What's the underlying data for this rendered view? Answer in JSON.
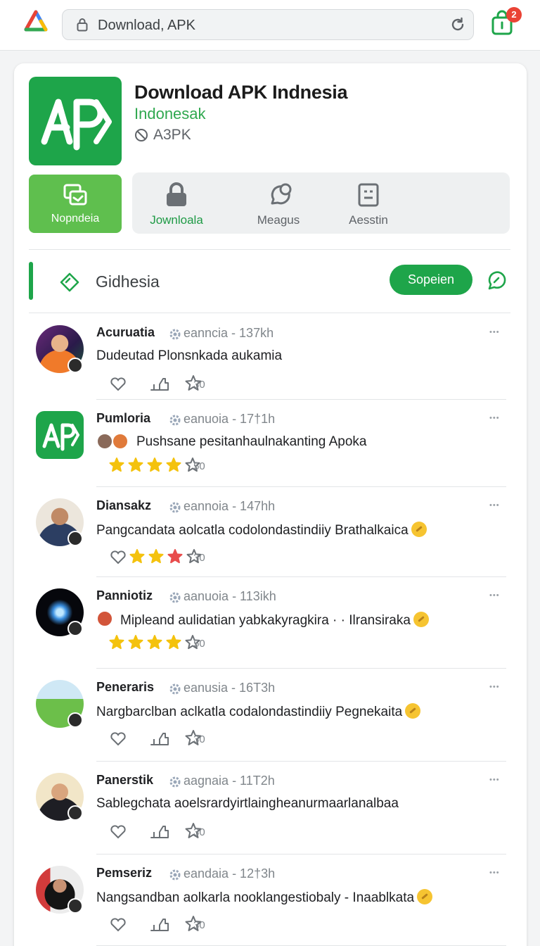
{
  "browser": {
    "url": "Download, APK",
    "notification_count": "2"
  },
  "app": {
    "title": "Download APK Indnesia",
    "subtitle": "Indonesak",
    "developer": "A3PK",
    "icon_text": "AP"
  },
  "actions": {
    "primary_label": "Nopndeia",
    "items": [
      {
        "label": "Jownloala",
        "icon": "lock-icon"
      },
      {
        "label": "Meagus",
        "icon": "chat-bubble-icon"
      },
      {
        "label": "Aesstin",
        "icon": "document-icon"
      }
    ]
  },
  "section": {
    "title": "Gidhesia",
    "button_label": "Sopeien"
  },
  "colors": {
    "brand_green": "#1ea54a",
    "button_light_green": "#5fbf4e",
    "star_gold": "#f4c20d",
    "star_red": "#e84c4c"
  },
  "posts": [
    {
      "name": "Acuruatia",
      "meta": "eanncia - 137kh",
      "text": "Dudeutad Plonsnkada aukamia",
      "count": "30",
      "rating": null
    },
    {
      "name": "Pumloria",
      "meta": "eanuoia - 17†1h",
      "text": "Pushsane pesitanhaulnakanting Apoka",
      "count": "50",
      "rating": 4,
      "red_stars": 0
    },
    {
      "name": "Diansakz",
      "meta": "eannoia - 147hh",
      "text": "Pangcandata aolcatla codolondastindiiy Brathalkaica",
      "count": "30",
      "rating": 3,
      "red_stars": 1
    },
    {
      "name": "Panniotiz",
      "meta": "aanuoia - 113ikh",
      "text": "Mipleand aulidatian yabkakyragkira · · Ilransiraka",
      "count": "50",
      "rating": 4,
      "red_stars": 0
    },
    {
      "name": "Peneraris",
      "meta": "eanusia - 16T3h",
      "text": "Nargbarclban aclkatla codalondastindiiy Pegnekaita",
      "count": "30",
      "rating": null
    },
    {
      "name": "Panerstik",
      "meta": "aagnaia - 11T2h",
      "text": "Sablegchata aoelsrardyirtlaingheanurmaarlanalbaa",
      "count": "30",
      "rating": null
    },
    {
      "name": "Pemseriz",
      "meta": "eandaia - 12†3h",
      "text": "Nangsandban aolkarla nooklangestiobaly - Inaablkata",
      "count": "30",
      "rating": null
    }
  ]
}
